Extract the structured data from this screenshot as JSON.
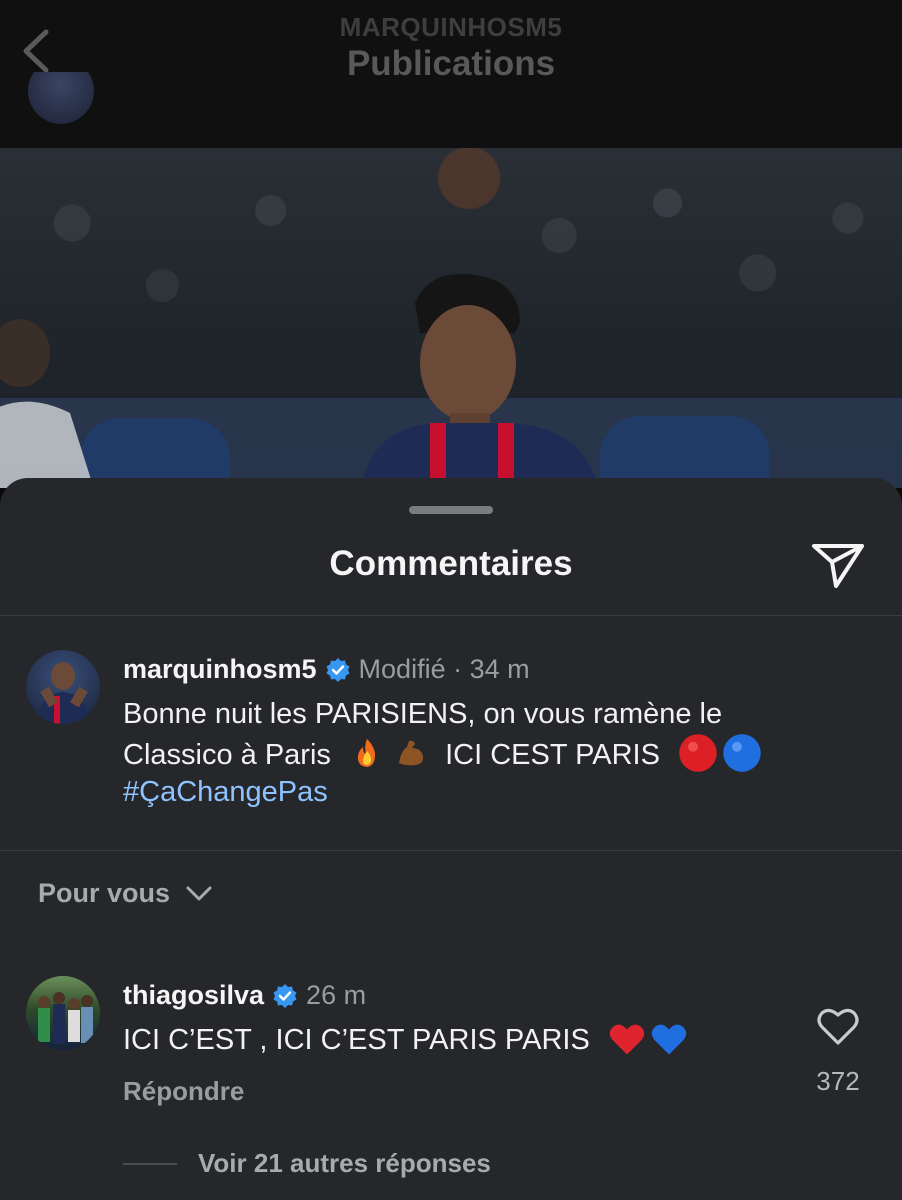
{
  "header": {
    "username": "MARQUINHOSM5",
    "title": "Publications"
  },
  "sheet": {
    "title": "Commentaires"
  },
  "caption": {
    "username": "marquinhosm5",
    "meta": "Modifié · 34 m",
    "line1": "Bonne nuit les PARISIENS, on vous ramène le",
    "line2_a": "Classico à Paris",
    "line2_b": "ICI CEST PARIS",
    "hashtag": "#ÇaChangePas",
    "emojis": [
      "fire",
      "flexed-biceps",
      "red-circle",
      "blue-circle"
    ]
  },
  "filter": {
    "label": "Pour vous"
  },
  "comments": [
    {
      "username": "thiagosilva",
      "time": "26 m",
      "text": "ICI C’EST , ICI C’EST PARIS PARIS",
      "emojis": [
        "red-heart",
        "blue-heart"
      ],
      "reply_label": "Répondre",
      "likes": "372",
      "more_replies": "Voir 21 autres réponses"
    }
  ],
  "colors": {
    "sheet_bg": "#25272b",
    "verified": "#3897f0",
    "hashtag": "#8fc3ff"
  }
}
